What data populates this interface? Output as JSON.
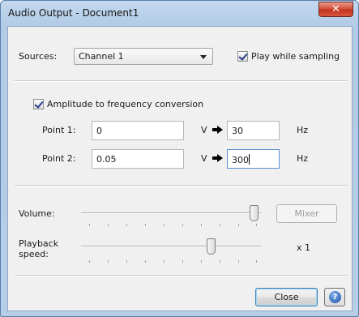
{
  "window": {
    "title": "Audio Output - Document1",
    "close_glyph": "✕"
  },
  "sources": {
    "label": "Sources:",
    "selected": "Channel 1"
  },
  "play_while_sampling": {
    "label": "Play while sampling",
    "checked": true
  },
  "conversion": {
    "label": "Amplitude to frequency conversion",
    "checked": true,
    "points": [
      {
        "label": "Point 1:",
        "volt_value": "0",
        "volt_unit": "V",
        "hz_value": "30",
        "hz_unit": "Hz"
      },
      {
        "label": "Point 2:",
        "volt_value": "0.05",
        "volt_unit": "V",
        "hz_value": "300",
        "hz_unit": "Hz"
      }
    ]
  },
  "volume": {
    "label": "Volume:",
    "level": 1.0,
    "mixer_label": "Mixer"
  },
  "playback": {
    "label_line1": "Playback",
    "label_line2": "speed:",
    "level": 0.75,
    "multiplier": "x 1"
  },
  "footer": {
    "close_label": "Close",
    "help_glyph": "?"
  },
  "colors": {
    "titlebar": "#b2cbe6",
    "client": "#f0f0f0",
    "close_button": "#c0321c",
    "help_icon": "#1d4fa5"
  },
  "icons": [
    "close-icon",
    "checkbox-checked-icon",
    "dropdown-arrow-icon",
    "right-arrow-icon",
    "help-icon"
  ]
}
